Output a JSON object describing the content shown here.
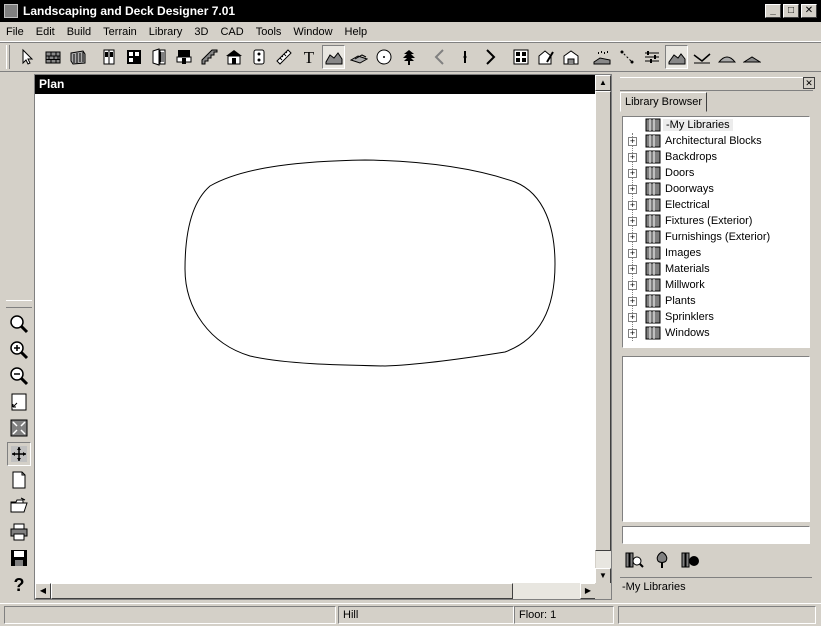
{
  "window": {
    "title": "Landscaping and Deck Designer 7.01",
    "minimize": "_",
    "maximize": "□",
    "close": "✕"
  },
  "menu": [
    "File",
    "Edit",
    "Build",
    "Terrain",
    "Library",
    "3D",
    "CAD",
    "Tools",
    "Window",
    "Help"
  ],
  "toolbar": {
    "text_tool_glyph": "T"
  },
  "plan": {
    "title": "Plan"
  },
  "library": {
    "tab": "Library Browser",
    "root": "-My Libraries",
    "items": [
      "Architectural Blocks",
      "Backdrops",
      "Doors",
      "Doorways",
      "Electrical",
      "Fixtures (Exterior)",
      "Furnishings (Exterior)",
      "Images",
      "Materials",
      "Millwork",
      "Plants",
      "Sprinklers",
      "Windows"
    ],
    "current_path": "-My Libraries"
  },
  "status": {
    "left": "",
    "mode": "Hill",
    "floor": "Floor: 1",
    "right": ""
  },
  "left_tools": {
    "help_glyph": "?"
  }
}
